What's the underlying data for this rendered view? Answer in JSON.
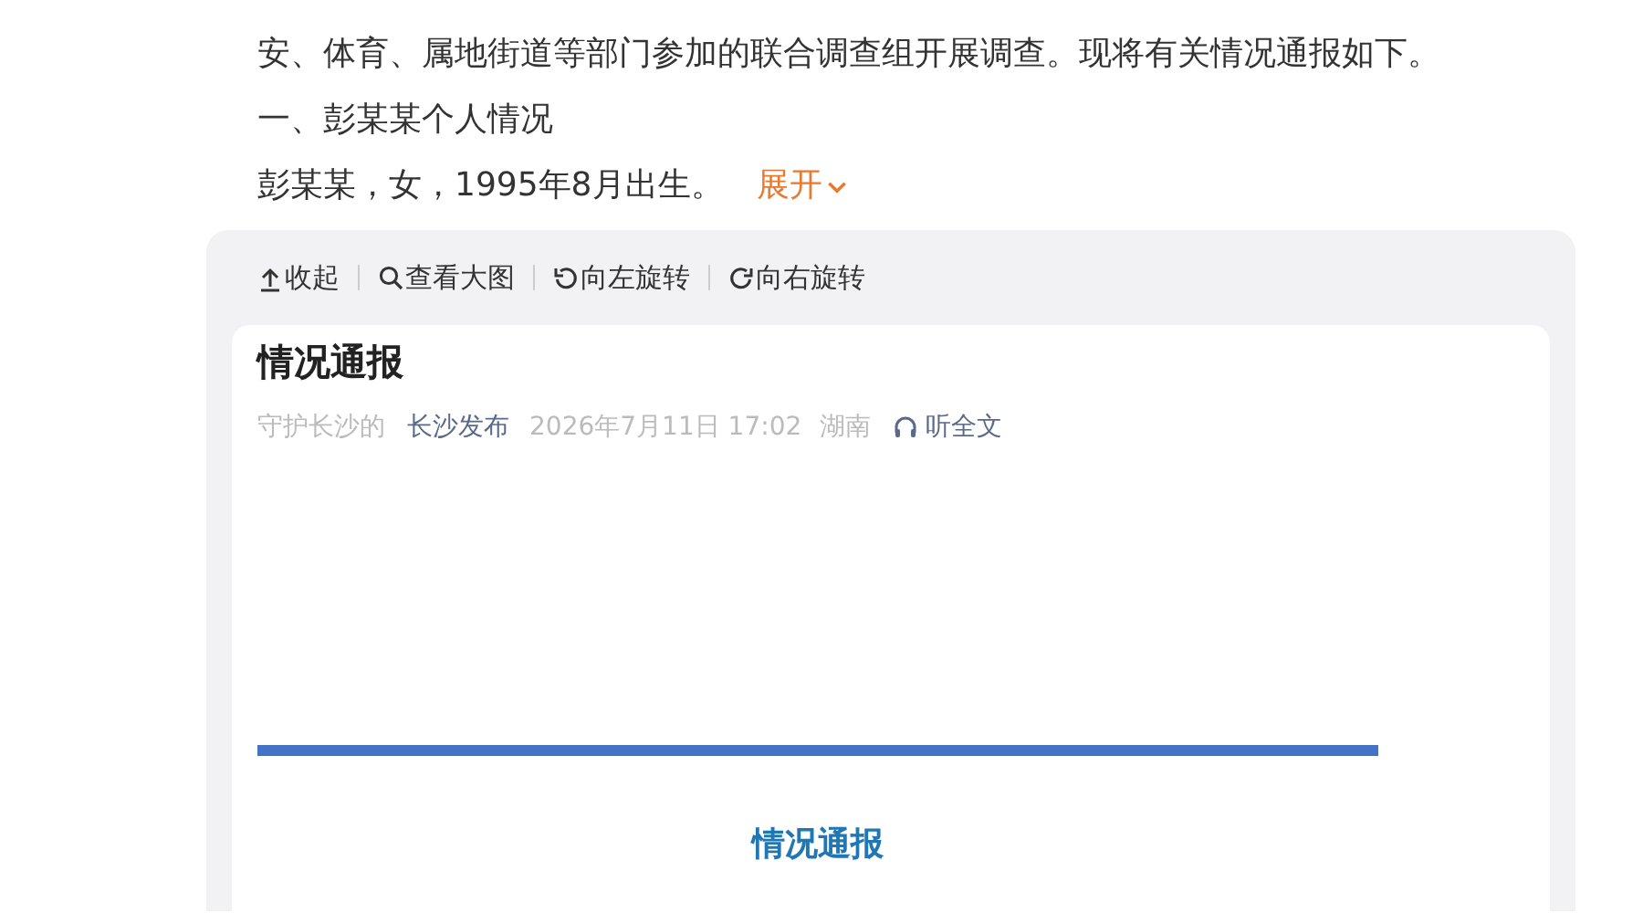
{
  "article": {
    "paragraphs": [
      "安、体育、属地街道等部门参加的联合调查组开展调查。现将有关情况通报如下。",
      "一、彭某某个人情况",
      "彭某某，女，1995年8月出生。"
    ],
    "expand_link": "展开"
  },
  "image_viewer": {
    "toolbar": [
      {
        "kind": "collapse",
        "label": "收起"
      },
      {
        "kind": "zoom",
        "label": "查看大图"
      },
      {
        "kind": "rotate_left",
        "label": "向左旋转"
      },
      {
        "kind": "rotate_right",
        "label": "向右旋转"
      }
    ],
    "document": {
      "title": "情况通报",
      "author": "守护长沙的",
      "source": "长沙发布",
      "date": "2026年7月11日 17:02",
      "location": "湖南",
      "listen": "听全文",
      "heading": "情况通报"
    }
  }
}
